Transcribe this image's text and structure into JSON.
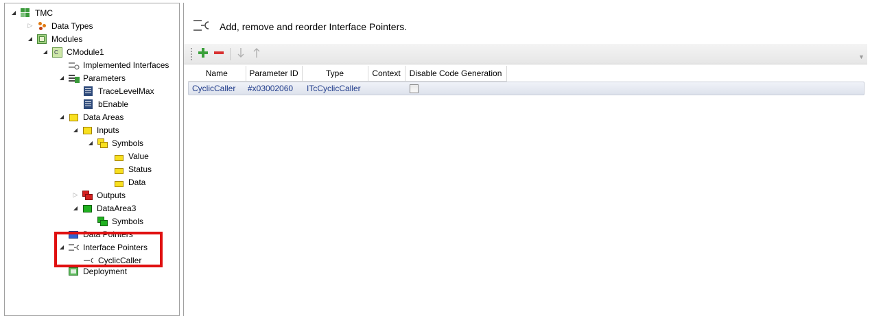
{
  "tree": {
    "nodes": [
      {
        "id": "tmc",
        "label": "TMC",
        "icon": "tmc-icon"
      },
      {
        "id": "data-types",
        "label": "Data Types",
        "icon": "data-types-icon"
      },
      {
        "id": "modules",
        "label": "Modules",
        "icon": "modules-icon"
      },
      {
        "id": "cmodule1",
        "label": "CModule1",
        "icon": "module-icon"
      },
      {
        "id": "implemented-interfaces",
        "label": "Implemented Interfaces",
        "icon": "interface-icon"
      },
      {
        "id": "parameters",
        "label": "Parameters",
        "icon": "parameters-icon"
      },
      {
        "id": "tracelevelmax",
        "label": "TraceLevelMax",
        "icon": "parameter-icon"
      },
      {
        "id": "benable",
        "label": "bEnable",
        "icon": "parameter-icon"
      },
      {
        "id": "data-areas",
        "label": "Data Areas",
        "icon": "folder-yellow-icon"
      },
      {
        "id": "inputs",
        "label": "Inputs",
        "icon": "folder-yellow-icon"
      },
      {
        "id": "symbols1",
        "label": "Symbols",
        "icon": "symbols-yellow-icon"
      },
      {
        "id": "value",
        "label": "Value",
        "icon": "symbol-yellow-icon"
      },
      {
        "id": "status",
        "label": "Status",
        "icon": "symbol-yellow-icon"
      },
      {
        "id": "data",
        "label": "Data",
        "icon": "symbol-yellow-icon"
      },
      {
        "id": "outputs",
        "label": "Outputs",
        "icon": "folder-red-icon"
      },
      {
        "id": "dataarea3",
        "label": "DataArea3",
        "icon": "folder-green-icon"
      },
      {
        "id": "symbols2",
        "label": "Symbols",
        "icon": "symbols-green-icon"
      },
      {
        "id": "data-pointers",
        "label": "Data Pointers",
        "icon": "data-pointers-icon"
      },
      {
        "id": "interface-pointers",
        "label": "Interface Pointers",
        "icon": "interface-pointer-icon"
      },
      {
        "id": "cycliccaller",
        "label": "CyclicCaller",
        "icon": "pointer-icon"
      },
      {
        "id": "deployment",
        "label": "Deployment",
        "icon": "deployment-icon"
      }
    ]
  },
  "header": {
    "description": "Add, remove and reorder Interface Pointers."
  },
  "toolbar": {
    "buttons": [
      "add",
      "remove",
      "move-down",
      "move-up"
    ]
  },
  "grid": {
    "columns": [
      "Name",
      "Parameter ID",
      "Type",
      "Context",
      "Disable Code Generation"
    ],
    "rows": [
      {
        "name": "CyclicCaller",
        "parameter_id": "#x03002060",
        "type": "ITcCyclicCaller",
        "context": "",
        "disable_code_generation": false
      }
    ]
  },
  "colors": {
    "accent_red": "#e01010",
    "link_blue": "#1e3a8a"
  }
}
